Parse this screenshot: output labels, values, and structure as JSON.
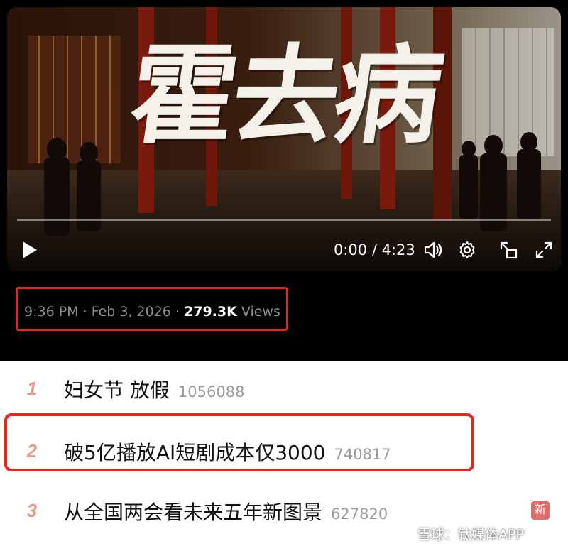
{
  "video": {
    "title_art": "霍去病",
    "time": "0:00 / 4:23",
    "controls": [
      "play-icon",
      "volume-icon",
      "settings-icon",
      "picture-in-picture-icon",
      "fullscreen-icon"
    ]
  },
  "post_meta": {
    "time": "9:36 PM",
    "sep1": " · ",
    "date": "Feb 3, 2026",
    "sep2": " · ",
    "views": "279.3K",
    "views_label": " Views"
  },
  "trending": [
    {
      "rank": "1",
      "title": "妇女节 放假",
      "count": "1056088"
    },
    {
      "rank": "2",
      "title": "破5亿播放AI短剧成本仅3000",
      "count": "740817"
    },
    {
      "rank": "3",
      "title": "从全国两会看未来五年新图景",
      "count": "627820",
      "badge": "新"
    }
  ],
  "watermark": "雪球：钛媒体APP",
  "colors": {
    "highlight": "#e4261c",
    "rank": "#e89a84",
    "badge": "#e36a6a"
  }
}
